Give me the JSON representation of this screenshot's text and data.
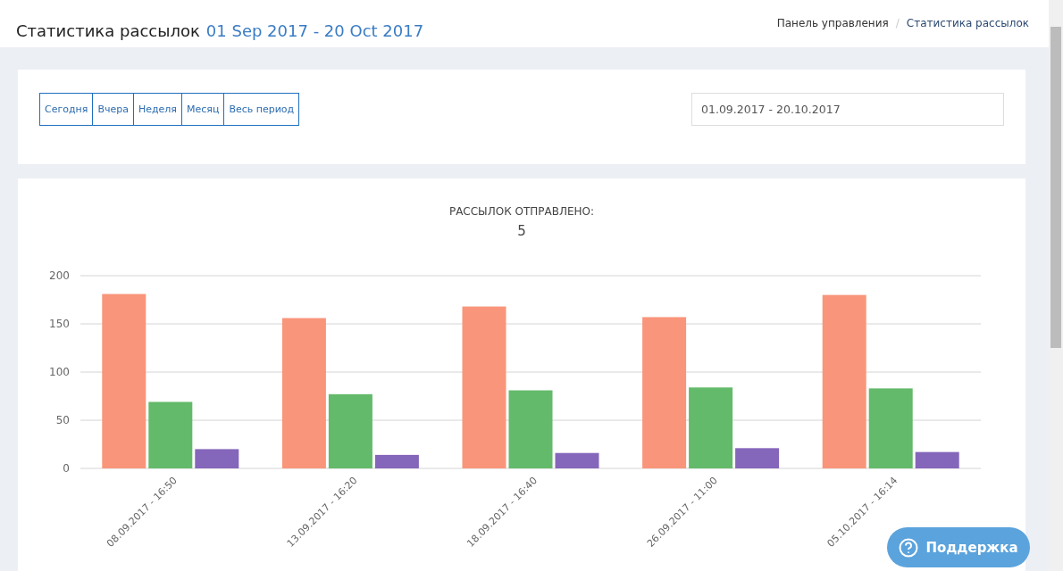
{
  "header": {
    "title": "Статистика рассылок",
    "period": "01 Sep 2017 - 20 Oct 2017",
    "breadcrumbs": [
      {
        "label": "Панель управления"
      },
      {
        "label": "Статистика рассылок"
      }
    ],
    "breadcrumb_separator": "/"
  },
  "filters": {
    "buttons": [
      {
        "label": "Сегодня"
      },
      {
        "label": "Вчера"
      },
      {
        "label": "Неделя"
      },
      {
        "label": "Месяц"
      },
      {
        "label": "Весь период"
      }
    ],
    "date_range": "01.09.2017 - 20.10.2017"
  },
  "summary": {
    "label": "РАССЫЛОК ОТПРАВЛЕНО:",
    "value": "5"
  },
  "chart_data": {
    "type": "bar",
    "categories": [
      "08.09.2017 - 16:50",
      "13.09.2017 - 16:20",
      "18.09.2017 - 16:40",
      "26.09.2017 - 11:00",
      "05.10.2017 - 16:14"
    ],
    "series": [
      {
        "color": "#f9957a",
        "values": [
          181,
          156,
          168,
          157,
          180
        ]
      },
      {
        "color": "#63ba6a",
        "values": [
          69,
          77,
          81,
          84,
          83
        ]
      },
      {
        "color": "#8466ba",
        "values": [
          20,
          14,
          16,
          21,
          17
        ]
      }
    ],
    "ylim": [
      0,
      200
    ],
    "yticks": [
      0,
      50,
      100,
      150,
      200
    ],
    "grid": true
  },
  "support_button": {
    "label": "Поддержка"
  }
}
